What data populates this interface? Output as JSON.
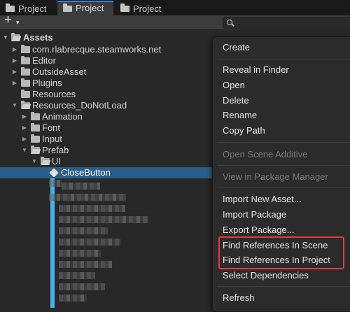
{
  "tabs": [
    {
      "label": "Project",
      "active": false
    },
    {
      "label": "Project",
      "active": true
    },
    {
      "label": "Project",
      "active": false
    }
  ],
  "toolbar": {
    "plus": "+",
    "caret": "▾"
  },
  "tree": {
    "root": "Assets",
    "items": [
      {
        "label": "com.rlabrecque.steamworks.net"
      },
      {
        "label": "Editor"
      },
      {
        "label": "OutsideAsset"
      },
      {
        "label": "Plugins"
      },
      {
        "label": "Resources"
      },
      {
        "label": "Resources_DoNotLoad"
      },
      {
        "label": "Animation"
      },
      {
        "label": "Font"
      },
      {
        "label": "Input"
      },
      {
        "label": "Prefab"
      },
      {
        "label": "UI"
      },
      {
        "label": "CloseButton"
      }
    ]
  },
  "menu": {
    "create": "Create",
    "reveal_in_finder": "Reveal in Finder",
    "open": "Open",
    "delete": "Delete",
    "rename": "Rename",
    "copy_path": "Copy Path",
    "open_scene_additive": "Open Scene Additive",
    "view_in_package_manager": "View in Package Manager",
    "import_new_asset": "Import New Asset...",
    "import_package": "Import Package",
    "export_package": "Export Package...",
    "find_references_in_scene": "Find References In Scene",
    "find_references_in_project": "Find References In Project",
    "select_dependencies": "Select Dependencies",
    "refresh": "Refresh"
  },
  "colors": {
    "selection": "#2c5d87",
    "highlight_box": "#e23b3f",
    "accent": "#3d7fe0"
  }
}
